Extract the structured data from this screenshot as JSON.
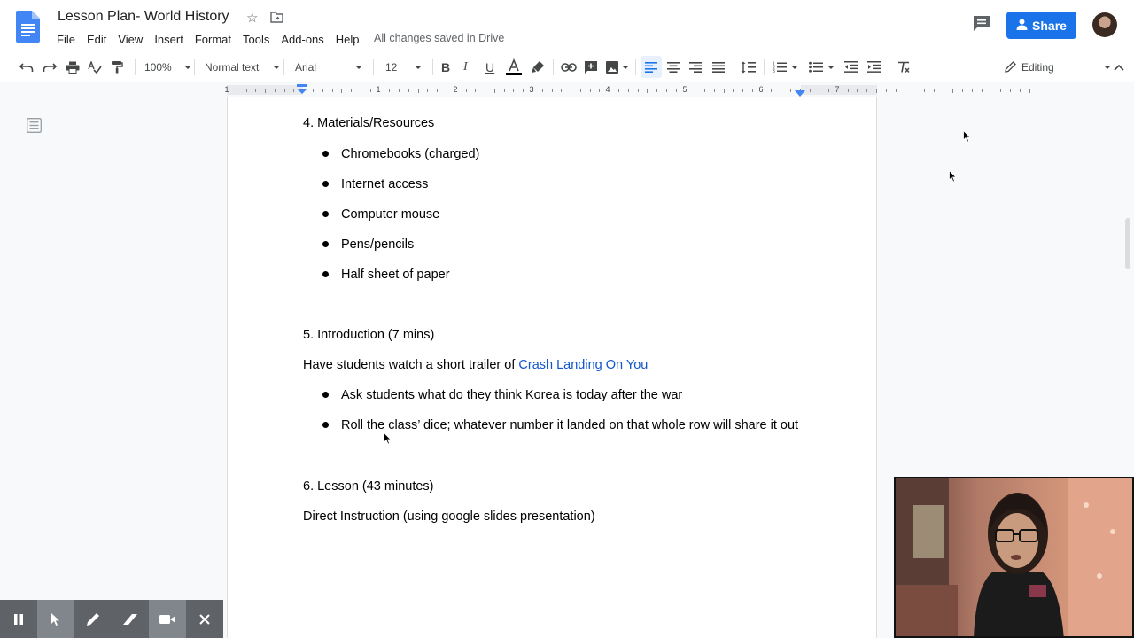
{
  "doc": {
    "title": "Lesson Plan- World History",
    "save_status": "All changes saved in Drive"
  },
  "menu": [
    "File",
    "Edit",
    "View",
    "Insert",
    "Format",
    "Tools",
    "Add-ons",
    "Help"
  ],
  "header": {
    "share_label": "Share"
  },
  "toolbar": {
    "zoom": "100%",
    "style": "Normal text",
    "font": "Arial",
    "font_size": "12",
    "mode": "Editing",
    "text_color": "#000000"
  },
  "ruler": {
    "numbers": [
      "1",
      "1",
      "2",
      "3",
      "4",
      "5",
      "6",
      "7"
    ]
  },
  "content": {
    "section4_heading": "4. Materials/Resources",
    "materials": [
      "Chromebooks (charged)",
      "Internet access",
      "Computer mouse",
      "Pens/pencils",
      "Half sheet of paper"
    ],
    "section5_heading": "5. Introduction (7 mins)",
    "intro_text": "Have students watch a short trailer of ",
    "intro_link": "Crash Landing On You",
    "intro_bullets": [
      "Ask students what do they think Korea is today after the war",
      "Roll the class’ dice; whatever number it landed on that whole row will share it out"
    ],
    "section6_heading": "6. Lesson (43 minutes)",
    "lesson_text": "Direct Instruction (using google slides presentation)"
  },
  "colors": {
    "accent": "#1a73e8",
    "link": "#1155cc",
    "recorder_bar": "#5f6368"
  }
}
